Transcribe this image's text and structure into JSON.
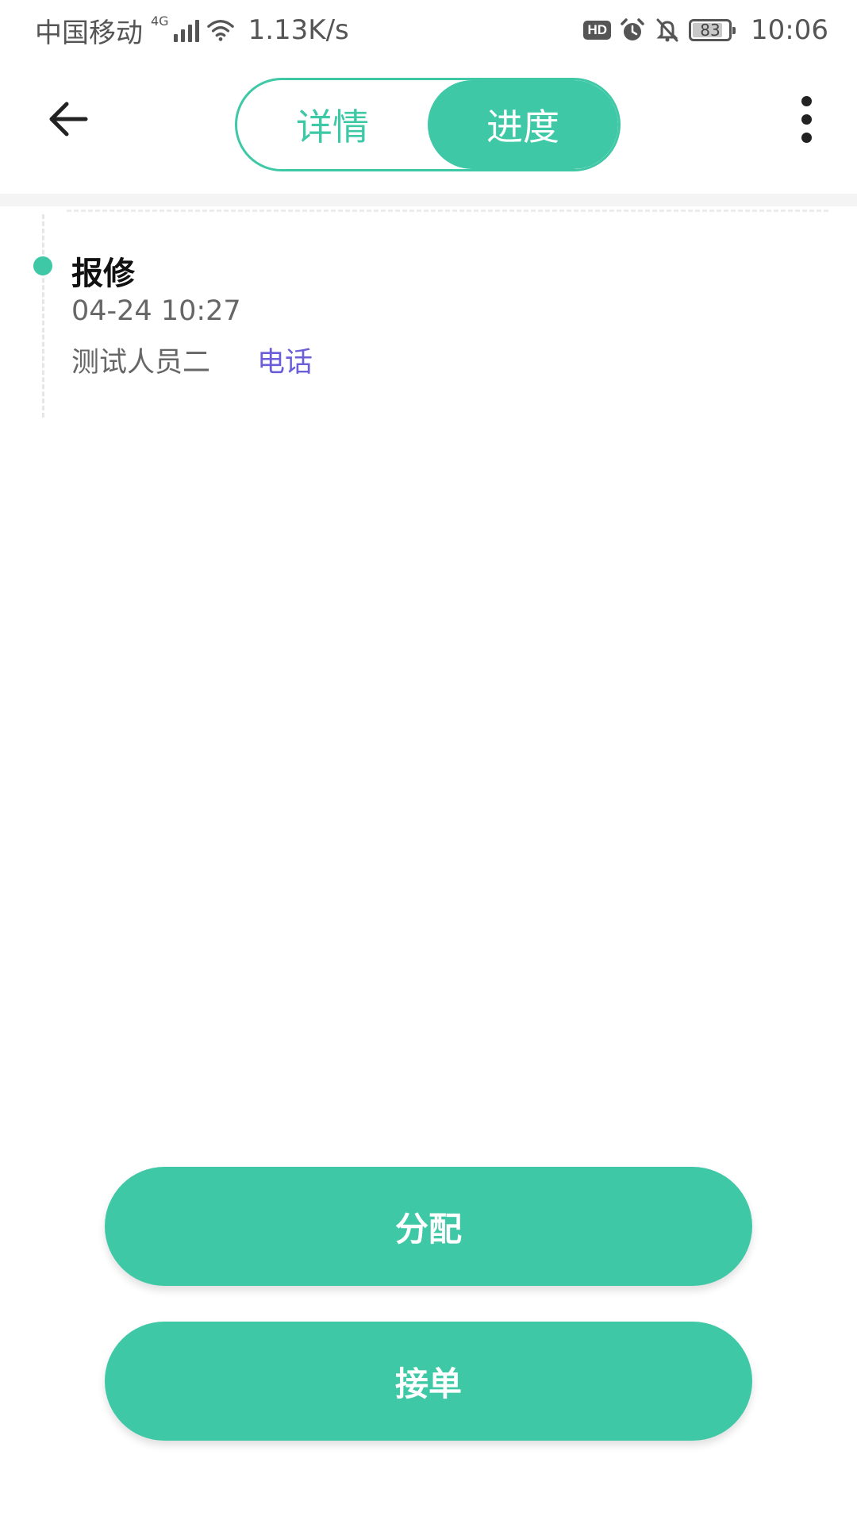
{
  "status_bar": {
    "carrier": "中国移动",
    "network": "4G",
    "speed": "1.13K/s",
    "battery": "83",
    "battery_level": 0.83,
    "time": "10:06",
    "icons": [
      "signal-icon",
      "wifi-icon",
      "hd-icon",
      "alarm-icon",
      "bell-muted-icon",
      "battery-icon"
    ]
  },
  "header": {
    "back_icon": "arrow-left-icon",
    "tabs": [
      {
        "label": "详情",
        "active": false
      },
      {
        "label": "进度",
        "active": true
      }
    ],
    "more_icon": "more-vertical-icon"
  },
  "timeline": {
    "entries": [
      {
        "title": "报修",
        "time": "04-24 10:27",
        "person": "测试人员二",
        "phone_label": "电话"
      }
    ]
  },
  "actions": {
    "assign_label": "分配",
    "accept_label": "接单"
  },
  "colors": {
    "accent": "#3ec8a6",
    "link": "#6a5fd8"
  }
}
